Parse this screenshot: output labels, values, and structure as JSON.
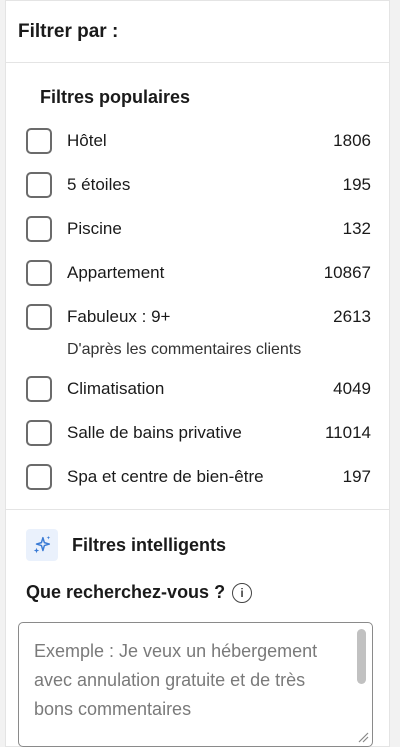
{
  "header": {
    "title": "Filtrer par :"
  },
  "popular": {
    "title": "Filtres populaires",
    "items": [
      {
        "label": "Hôtel",
        "count": "1806"
      },
      {
        "label": "5 étoiles",
        "count": "195"
      },
      {
        "label": "Piscine",
        "count": "132"
      },
      {
        "label": "Appartement",
        "count": "10867"
      },
      {
        "label": "Fabuleux : 9+",
        "count": "2613",
        "sub": "D'après les commentaires clients"
      },
      {
        "label": "Climatisation",
        "count": "4049"
      },
      {
        "label": "Salle de bains privative",
        "count": "11014"
      },
      {
        "label": "Spa et centre de bien-être",
        "count": "197"
      }
    ]
  },
  "smart": {
    "title": "Filtres intelligents",
    "icon": "sparkle-icon",
    "question": "Que recherchez-vous ?",
    "info_icon": "info-icon",
    "placeholder": "Exemple : Je veux un hébergement avec annulation gratuite et de très bons commentaires"
  },
  "colors": {
    "sparkle": "#3a7bd5",
    "sparkle_bg": "#eaf1fc",
    "border": "#e4e4e4"
  }
}
